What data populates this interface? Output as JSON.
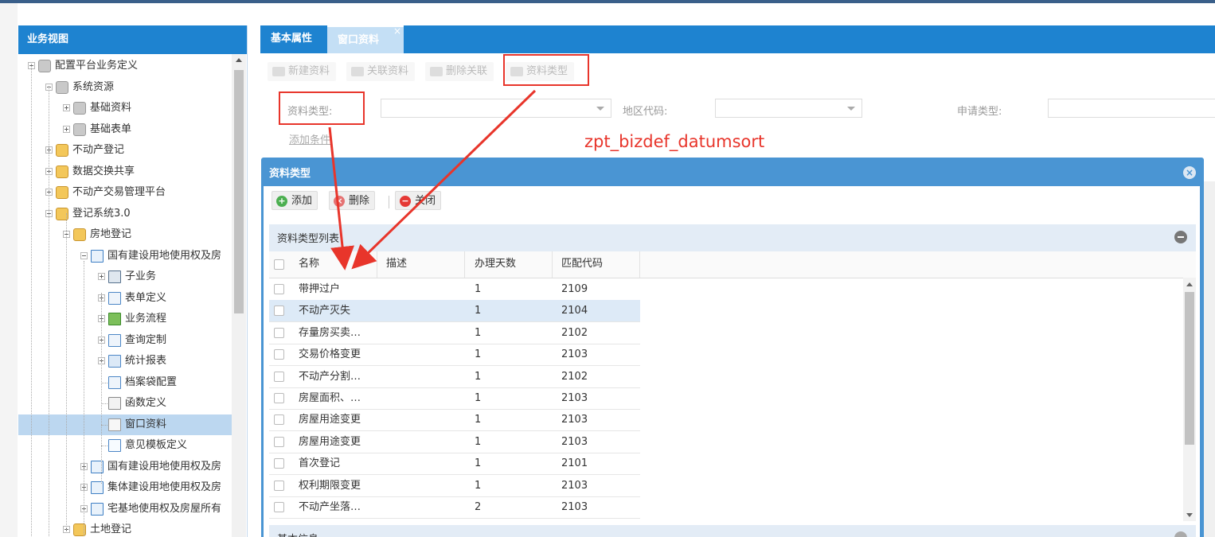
{
  "left_panel": {
    "title": "业务视图",
    "tree": [
      {
        "label": "配置平台业务定义",
        "toggle": "minus",
        "icon": "gray-box-icon"
      },
      {
        "label": "系统资源",
        "toggle": "minus",
        "icon": "gray-box-icon"
      },
      {
        "label": "基础资料",
        "toggle": "plus",
        "icon": "gray-box-icon"
      },
      {
        "label": "基础表单",
        "toggle": "plus",
        "icon": "gray-box-icon"
      },
      {
        "label": "不动产登记",
        "toggle": "plus",
        "icon": "yellow-box-icon"
      },
      {
        "label": "数据交换共享",
        "toggle": "plus",
        "icon": "yellow-box-icon"
      },
      {
        "label": "不动产交易管理平台",
        "toggle": "plus",
        "icon": "yellow-box-icon"
      },
      {
        "label": "登记系统3.0",
        "toggle": "minus",
        "icon": "yellow-box-icon"
      },
      {
        "label": "房地登记",
        "toggle": "minus",
        "icon": "yellow-box-icon"
      },
      {
        "label": "国有建设用地使用权及房",
        "toggle": "minus",
        "icon": "window-icon"
      },
      {
        "label": "子业务",
        "toggle": "plus",
        "icon": "sub-business-icon"
      },
      {
        "label": "表单定义",
        "toggle": "plus",
        "icon": "form-icon"
      },
      {
        "label": "业务流程",
        "toggle": "plus",
        "icon": "workflow-icon"
      },
      {
        "label": "查询定制",
        "toggle": "plus",
        "icon": "query-icon"
      },
      {
        "label": "统计报表",
        "toggle": "plus",
        "icon": "report-icon"
      },
      {
        "label": "档案袋配置",
        "toggle": "none",
        "icon": "archive-icon"
      },
      {
        "label": "函数定义",
        "toggle": "none",
        "icon": "function-icon"
      },
      {
        "label": "窗口资料",
        "toggle": "none",
        "icon": "document-icon",
        "selected": true
      },
      {
        "label": "意见模板定义",
        "toggle": "none",
        "icon": "comment-icon"
      },
      {
        "label": "国有建设用地使用权及房",
        "toggle": "plus",
        "icon": "window-icon"
      },
      {
        "label": "集体建设用地使用权及房",
        "toggle": "plus",
        "icon": "window-icon"
      },
      {
        "label": "宅基地使用权及房屋所有",
        "toggle": "plus",
        "icon": "window-icon"
      },
      {
        "label": "土地登记",
        "toggle": "plus",
        "icon": "yellow-box-icon"
      }
    ]
  },
  "tabs": [
    {
      "label": "基本属性",
      "active": false
    },
    {
      "label": "窗口资料",
      "active": true,
      "close": "×"
    }
  ],
  "toolbar": {
    "new_label": "新建资料",
    "link_label": "关联资料",
    "unlink_label": "删除关联",
    "type_label": "资料类型"
  },
  "filters": {
    "material_type_label": "资料类型:",
    "region_code_label": "地区代码:",
    "apply_type_label": "申请类型:",
    "add_condition_label": "添加条件"
  },
  "annotation": {
    "text": "zpt_bizdef_datumsort",
    "color": "#e8352b"
  },
  "dialog": {
    "title": "资料类型",
    "close_icon": "×",
    "add_label": "添加",
    "delete_label": "删除",
    "close_label": "关闭",
    "list_title": "资料类型列表",
    "columns": [
      "名称",
      "描述",
      "办理天数",
      "匹配代码"
    ],
    "rows": [
      {
        "name": "带押过户",
        "desc": "",
        "days": "1",
        "code": "2109"
      },
      {
        "name": "不动产灭失",
        "desc": "",
        "days": "1",
        "code": "2104"
      },
      {
        "name": "存量房买卖…",
        "desc": "",
        "days": "1",
        "code": "2102"
      },
      {
        "name": "交易价格变更",
        "desc": "",
        "days": "1",
        "code": "2103"
      },
      {
        "name": "不动产分割…",
        "desc": "",
        "days": "1",
        "code": "2102"
      },
      {
        "name": "房屋面积、…",
        "desc": "",
        "days": "1",
        "code": "2103"
      },
      {
        "name": "房屋用途变更",
        "desc": "",
        "days": "1",
        "code": "2103"
      },
      {
        "name": "房屋用途变更",
        "desc": "",
        "days": "1",
        "code": "2103"
      },
      {
        "name": "首次登记",
        "desc": "",
        "days": "1",
        "code": "2101"
      },
      {
        "name": "权利期限变更",
        "desc": "",
        "days": "1",
        "code": "2103"
      },
      {
        "name": "不动产坐落…",
        "desc": "",
        "days": "2",
        "code": "2103"
      }
    ],
    "second_panel_title": "基本信息"
  },
  "colors": {
    "header_blue": "#1e83d0",
    "dialog_blue": "#4a95d3",
    "annotation_red": "#e8352b",
    "selected_row": "#bcd7f0"
  }
}
